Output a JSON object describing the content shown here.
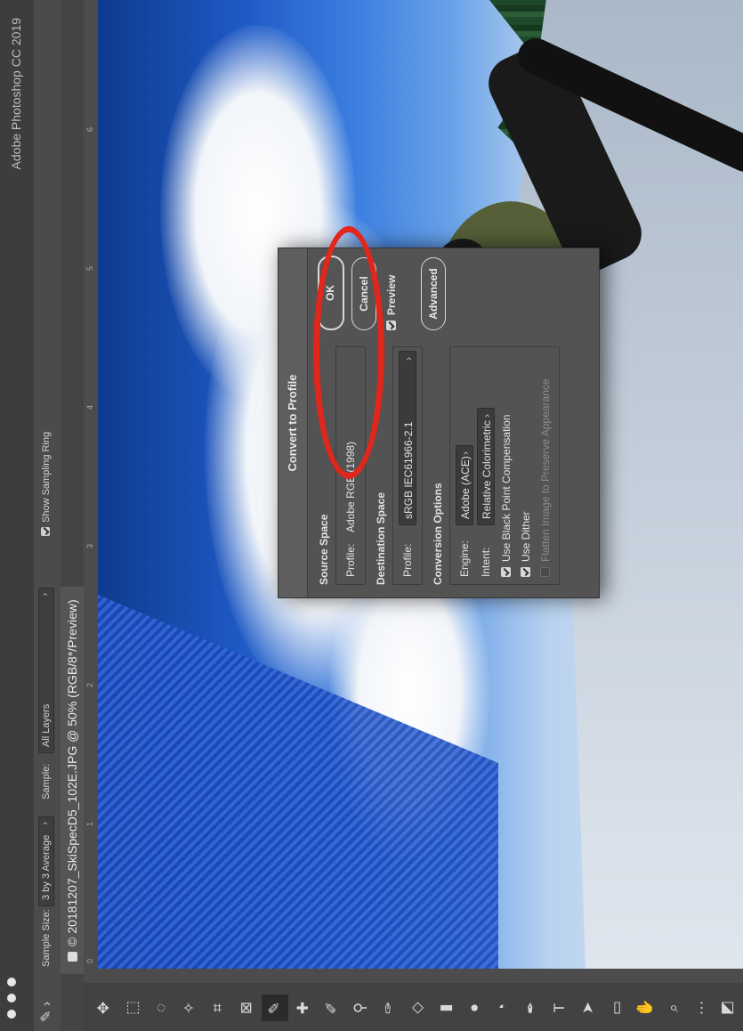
{
  "app": {
    "title": "Adobe Photoshop CC 2019"
  },
  "options_bar": {
    "sample_size_label": "Sample Size:",
    "sample_size_value": "3 by 3 Average",
    "sample_label": "Sample:",
    "sample_value": "All Layers",
    "show_sampling_ring": "Show Sampling Ring"
  },
  "document": {
    "tab_title": "20181207_SkiSpecD5_102E.JPG @ 50% (RGB/8*/Preview)",
    "ruler_ticks": [
      "0",
      "1",
      "2",
      "3",
      "4",
      "5",
      "6"
    ]
  },
  "dialog": {
    "title": "Convert to Profile",
    "source_space": {
      "heading": "Source Space",
      "profile_label": "Profile:",
      "profile_value": "Adobe RGB (1998)"
    },
    "destination_space": {
      "heading": "Destination Space",
      "profile_label": "Profile:",
      "profile_value": "sRGB IEC61966-2.1"
    },
    "conversion_options": {
      "heading": "Conversion Options",
      "engine_label": "Engine:",
      "engine_value": "Adobe (ACE)",
      "intent_label": "Intent:",
      "intent_value": "Relative Colorimetric",
      "black_point": "Use Black Point Compensation",
      "dither": "Use Dither",
      "flatten": "Flatten Image to Preserve Appearance"
    },
    "buttons": {
      "ok": "OK",
      "cancel": "Cancel",
      "advanced": "Advanced"
    },
    "preview_label": "Preview"
  },
  "colors": {
    "highlight": "#e1261c",
    "panel": "#535353"
  }
}
